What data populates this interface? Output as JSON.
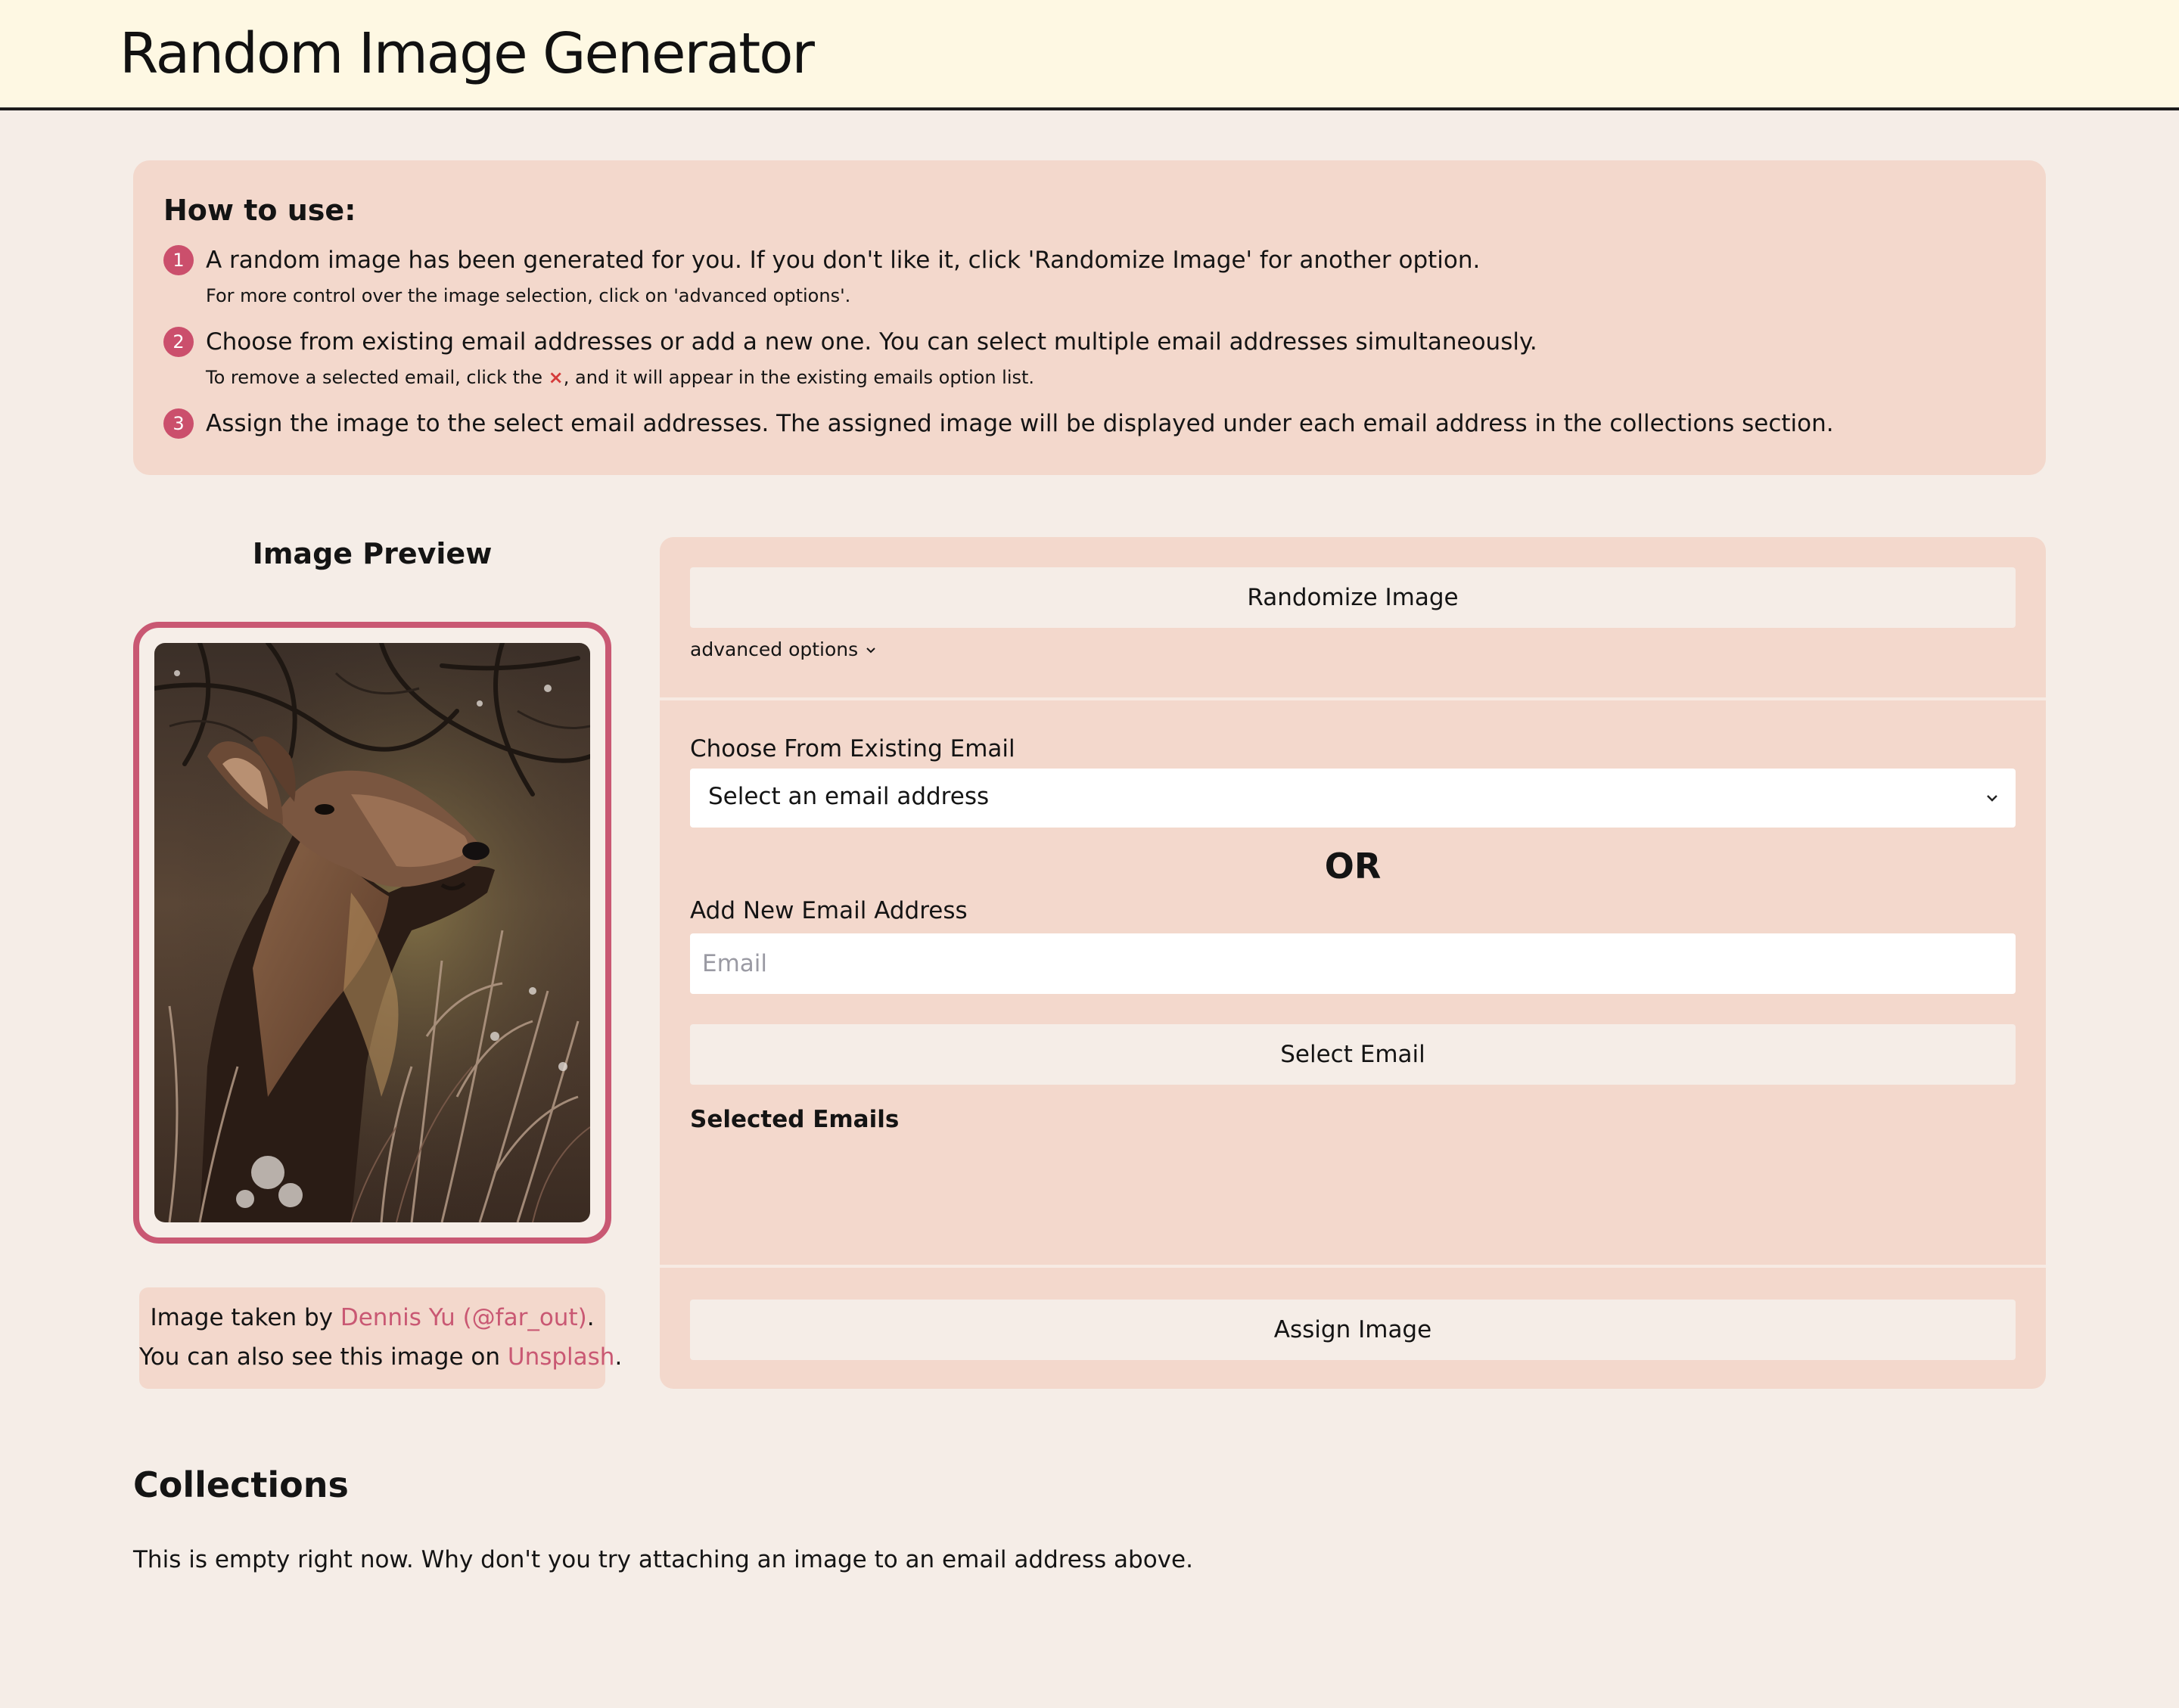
{
  "header": {
    "title": "Random Image Generator"
  },
  "how_to": {
    "heading": "How to use:",
    "steps": [
      {
        "num": "1",
        "text": "A random image has been generated for you. If you don't like it, click 'Randomize Image' for another option.",
        "note": "For more control over the image selection, click on 'advanced options'."
      },
      {
        "num": "2",
        "text": "Choose from existing email addresses or add a new one. You can select multiple email addresses simultaneously.",
        "note_before": "To remove a selected email, click the",
        "note_icon": "×",
        "note_after": ", and it will appear in the existing emails option list."
      },
      {
        "num": "3",
        "text": "Assign the image to the select email addresses. The assigned image will be displayed under each email address in the collections section."
      }
    ]
  },
  "preview": {
    "title": "Image Preview",
    "image_alt": "elk-photo",
    "credit_prefix": "Image taken by",
    "credit_author": "Dennis Yu (@far_out)",
    "credit_mid": "You can also see this image on",
    "credit_site": "Unsplash",
    "period": "."
  },
  "form": {
    "randomize_label": "Randomize Image",
    "advanced_label": "advanced options",
    "choose_label": "Choose From Existing Email",
    "select_value": "Select an email address",
    "or_label": "OR",
    "add_label": "Add New Email Address",
    "email_placeholder": "Email",
    "select_email_label": "Select Email",
    "selected_heading": "Selected Emails",
    "assign_label": "Assign Image"
  },
  "collections": {
    "title": "Collections",
    "empty_text": "This is empty right now. Why don't you try attaching an image to an email address above."
  },
  "colors": {
    "accent": "#cb4f6c",
    "header_bg": "#fef8e3",
    "panel_bg": "#f3d8cc",
    "page_bg": "#f5ede7"
  }
}
